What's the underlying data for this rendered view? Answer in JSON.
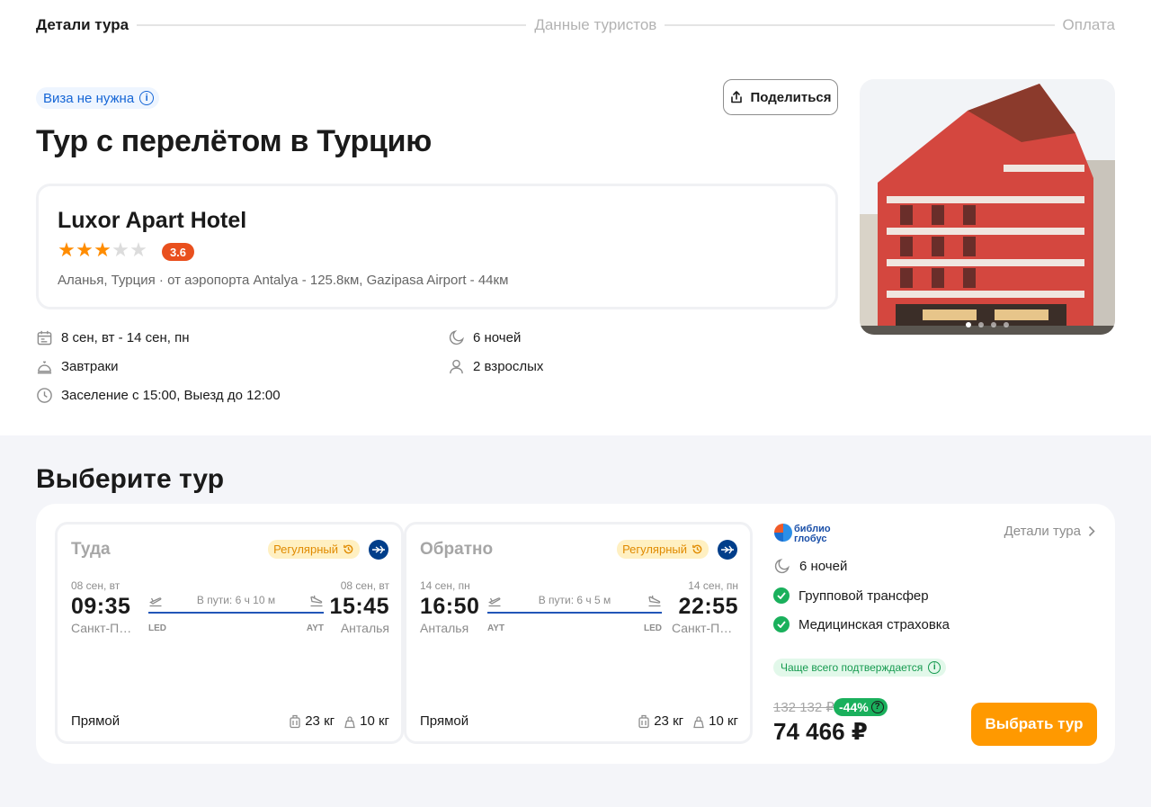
{
  "stepper": {
    "steps": [
      "Детали тура",
      "Данные туристов",
      "Оплата"
    ],
    "active_index": 0
  },
  "tour": {
    "visa_badge": "Виза не нужна",
    "share_label": "Поделиться",
    "title": "Тур с перелётом в Турцию"
  },
  "hotel": {
    "name": "Luxor Apart Hotel",
    "stars": 3,
    "max_stars": 5,
    "rating": "3.6",
    "location": "Аланья, Турция · от аэропорта Antalya - 125.8км, Gazipasa Airport - 44км",
    "photo_count": 4,
    "photo_index": 0
  },
  "facts": {
    "dates": "8 сен, вт - 14 сен, пн",
    "nights": "6 ночей",
    "meals": "Завтраки",
    "guests": "2 взрослых",
    "checkin": "Заселение с 15:00, Выезд до 12:00"
  },
  "choose": {
    "title": "Выберите тур"
  },
  "outbound": {
    "direction": "Туда",
    "badge": "Регулярный",
    "dep_date": "08 сен, вт",
    "dep_time": "09:35",
    "dep_city": "Санкт-Петербург",
    "dep_code": "LED",
    "duration": "В пути: 6 ч 10 м",
    "arr_date": "08 сен, вт",
    "arr_time": "15:45",
    "arr_city": "Анталья",
    "arr_code": "AYT",
    "type": "Прямой",
    "baggage": "23 кг",
    "hand_luggage": "10 кг"
  },
  "inbound": {
    "direction": "Обратно",
    "badge": "Регулярный",
    "dep_date": "14 сен, пн",
    "dep_time": "16:50",
    "dep_city": "Анталья",
    "dep_code": "AYT",
    "duration": "В пути: 6 ч 5 м",
    "arr_date": "14 сен, пн",
    "arr_time": "22:55",
    "arr_city": "Санкт-Петербург",
    "arr_code": "LED",
    "type": "Прямой",
    "baggage": "23 кг",
    "hand_luggage": "10 кг"
  },
  "offer": {
    "operator_logo_text": "библио глобус",
    "details_link": "Детали тура",
    "nights": "6 ночей",
    "features": [
      "Групповой трансфер",
      "Медицинская страховка"
    ],
    "confirm_badge": "Чаще всего подтверждается",
    "old_price": "132 132 ₽",
    "discount": "-44%",
    "price": "74 466 ₽",
    "select_label": "Выбрать тур"
  },
  "colors": {
    "accent": "#ff9900",
    "success": "#1ab05c",
    "rating": "#e9501e",
    "link": "#1666d6"
  }
}
